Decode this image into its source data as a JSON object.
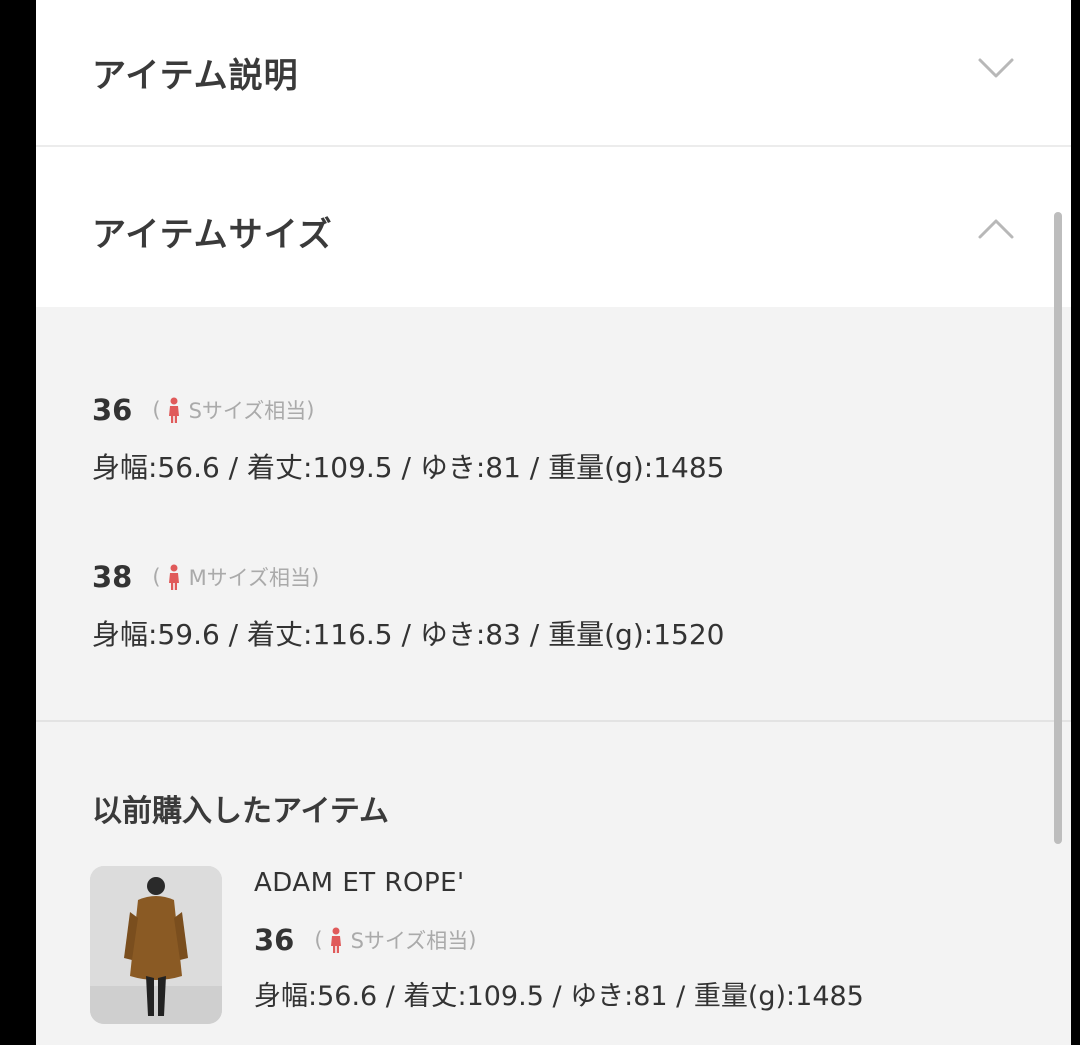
{
  "accordion": {
    "description": {
      "title": "アイテム説明",
      "state": "collapsed",
      "icon": "chevron-down-icon"
    },
    "size": {
      "title": "アイテムサイズ",
      "state": "expanded",
      "icon": "chevron-up-icon"
    }
  },
  "sizes": [
    {
      "size": "36",
      "open_paren": "(",
      "equivalent": "Sサイズ相当",
      "close_paren": ")",
      "measurements": "身幅:56.6 / 着丈:109.5 / ゆき:81 / 重量(g):1485"
    },
    {
      "size": "38",
      "open_paren": "(",
      "equivalent": "Mサイズ相当",
      "close_paren": ")",
      "measurements": "身幅:59.6 / 着丈:116.5 / ゆき:83 / 重量(g):1520"
    }
  ],
  "previous_purchase": {
    "title": "以前購入したアイテム",
    "brand": "ADAM ET ROPE'",
    "size": "36",
    "open_paren": "(",
    "equivalent": "Sサイズ相当",
    "close_paren": ")",
    "measurements": "身幅:56.6 / 着丈:109.5 / ゆき:81 / 重量(g):1485"
  },
  "colors": {
    "accent_person_icon": "#e05a5a",
    "header_bg": "#ffffff",
    "panel_bg": "#f3f3f3"
  }
}
